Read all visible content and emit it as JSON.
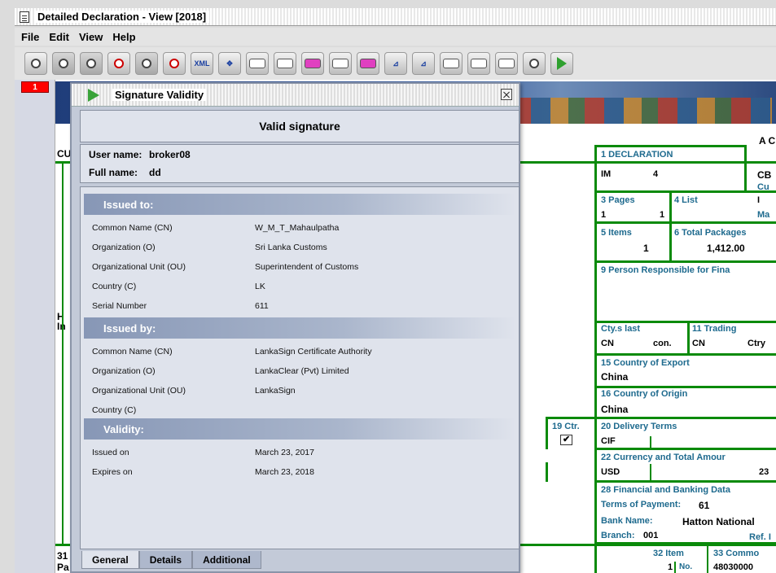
{
  "window": {
    "title": "Detailed Declaration - View [2018]"
  },
  "menu": [
    "File",
    "Edit",
    "View",
    "Help"
  ],
  "toolbar": {
    "xml_label": "XML"
  },
  "page_badge": "1",
  "form": {
    "a_c": "A C",
    "cu": "CU",
    "declaration_label": "1   DECLARATION",
    "decl_im": "IM",
    "decl_4": "4",
    "cb": "CB",
    "cu2": "Cu",
    "i_label": "I",
    "ma": "Ma",
    "pages_label": "3 Pages",
    "list_label": "4 List",
    "pages_1a": "1",
    "pages_1b": "1",
    "items_label": "5 Items",
    "items_val": "1",
    "total_packages_label": "6 Total Packages",
    "total_packages_val": "1,412.00",
    "person_resp": "9 Person Responsible for Fina",
    "ctys_last": "Cty.s last",
    "trading": "11 Trading",
    "cn1": "CN",
    "con": "con.",
    "cn2": "CN",
    "ctry": "Ctry",
    "country_export_label": "15 Country of Export",
    "country_export_val": "China",
    "country_origin_label": "16 Country of Origin",
    "country_origin_val": "China",
    "ctr_label": "19 Ctr.",
    "delivery_terms_label": "20 Delivery Terms",
    "delivery_terms_val": "CIF",
    "currency_label": "22 Currency and Total Amour",
    "currency_val": "USD",
    "amount_partial": "23",
    "financial_label": "28 Financial and Banking Data",
    "terms_payment": "Terms of Payment:",
    "terms_payment_val": "61",
    "bank_name": "Bank Name:",
    "bank_name_val": "Hatton National",
    "branch": "Branch:",
    "branch_val": "001",
    "ref": "Ref. I",
    "item_label": "32 Item",
    "item_no_val": "1",
    "no_label": "No.",
    "commo_label": "33 Commo",
    "commo_val": "48030000",
    "left_h": "H",
    "left_in": "In",
    "left_31": "31",
    "left_pa": "Pa"
  },
  "dialog": {
    "title": "Signature Validity",
    "status": "Valid signature",
    "user_name_label": "User name:",
    "user_name": "broker08",
    "full_name_label": "Full name:",
    "full_name": "dd",
    "issued_to": {
      "header": "Issued to:",
      "rows": [
        {
          "k": "Common Name (CN)",
          "v": "W_M_T_Mahaulpatha"
        },
        {
          "k": "Organization (O)",
          "v": "Sri Lanka Customs"
        },
        {
          "k": "Organizational Unit (OU)",
          "v": "Superintendent of Customs"
        },
        {
          "k": "Country (C)",
          "v": "LK"
        },
        {
          "k": "Serial Number",
          "v": "611"
        }
      ]
    },
    "issued_by": {
      "header": "Issued by:",
      "rows": [
        {
          "k": "Common Name (CN)",
          "v": "LankaSign Certificate Authority"
        },
        {
          "k": "Organization (O)",
          "v": "LankaClear (Pvt) Limited"
        },
        {
          "k": "Organizational Unit (OU)",
          "v": "LankaSign"
        },
        {
          "k": "Country (C)",
          "v": ""
        }
      ]
    },
    "validity": {
      "header": "Validity:",
      "rows": [
        {
          "k": "Issued on",
          "v": "March 23, 2017"
        },
        {
          "k": "Expires on",
          "v": "March 23, 2018"
        }
      ]
    },
    "tabs": [
      "General",
      "Details",
      "Additional"
    ]
  }
}
